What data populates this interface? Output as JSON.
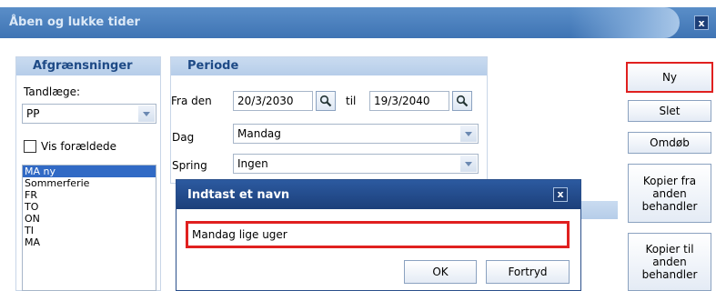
{
  "window": {
    "title": "Åben og lukke tider",
    "close_label": "x"
  },
  "filters": {
    "header": "Afgrænsninger",
    "dentist_label": "Tandlæge:",
    "dentist_value": "PP",
    "show_old_label": "Vis forældede",
    "list_items": [
      "MA ny",
      "Sommerferie",
      "FR",
      "TO",
      "ON",
      "TI",
      "MA"
    ],
    "selected_item": "MA ny"
  },
  "period": {
    "header": "Periode",
    "from_label": "Fra den",
    "from_value": "20/3/2030",
    "to_label": "til",
    "to_value": "19/3/2040",
    "day_label": "Dag",
    "day_value": "Mandag",
    "skip_label": "Spring",
    "skip_value": "Ingen"
  },
  "side_buttons": {
    "new": "Ny",
    "delete": "Slet",
    "rename": "Omdøb",
    "copy_from": [
      "Kopier fra",
      "anden",
      "behandler"
    ],
    "copy_to": [
      "Kopier til",
      "anden",
      "behandler"
    ]
  },
  "dialog": {
    "title": "Indtast et navn",
    "close_label": "x",
    "input_value": "Mandag lige uger",
    "ok": "OK",
    "cancel": "Fortryd"
  },
  "colors": {
    "titlebar": "#3f74b4",
    "group_header_text": "#1e4a86",
    "highlight": "#e0201f",
    "selection": "#316ac5"
  }
}
